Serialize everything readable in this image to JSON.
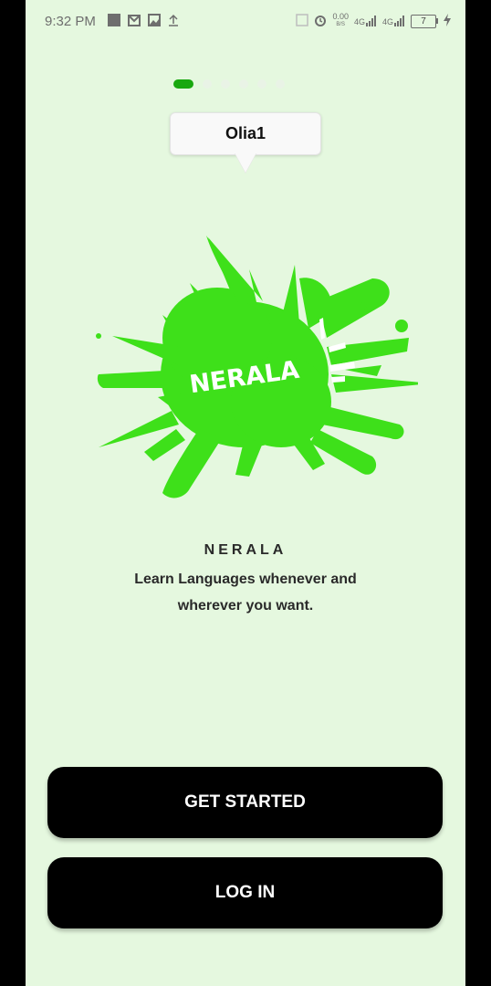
{
  "status_bar": {
    "time": "9:32 PM",
    "network_speed": "0.00",
    "network_unit": "B/S",
    "signal_1": "4G",
    "signal_2": "4G",
    "battery": "7"
  },
  "pager": {
    "total_pages": 6,
    "active_page": 1
  },
  "tooltip": {
    "text": "Olia1"
  },
  "logo": {
    "text": "NERALA",
    "color": "#3ee01a"
  },
  "brand": {
    "title": "NERALA"
  },
  "tagline": "Learn Languages whenever and wherever you want.",
  "buttons": {
    "get_started": "GET STARTED",
    "log_in": "LOG IN"
  },
  "colors": {
    "background": "#e5f8df",
    "accent": "#18a80f",
    "button_bg": "#000000",
    "button_text": "#ffffff"
  }
}
